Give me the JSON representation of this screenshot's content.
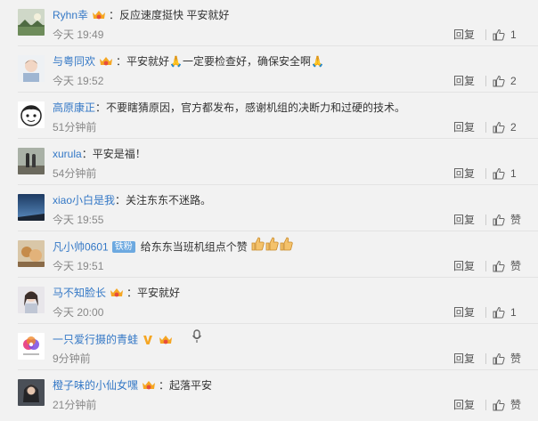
{
  "reply_label": "回复",
  "zan_label": "赞",
  "comments": [
    {
      "user": "Ryhn幸",
      "text": "：反应速度挺快 平安就好",
      "time": "今天 19:49",
      "likes": "1",
      "avatar": "landscape-avatar"
    },
    {
      "user": "与粤同欢",
      "text": "：平安就好🙏一定要检查好，确保安全啊🙏",
      "time": "今天 19:52",
      "likes": "2",
      "avatar": "child-avatar"
    },
    {
      "user": "高原康正",
      "text": "：不要瞎猜原因，官方都发布，感谢机组的决断力和过硬的技术。",
      "time": "51分钟前",
      "likes": "2",
      "avatar": "cartoon-face-avatar"
    },
    {
      "user": "xurula",
      "text": "：平安是福！",
      "time": "54分钟前",
      "likes": "1",
      "avatar": "couple-avatar"
    },
    {
      "user": "xiao小白是我",
      "text": "：关注东东不迷路。",
      "time": "今天 19:55",
      "likes": "",
      "avatar": "night-sky-avatar"
    },
    {
      "user": "凡小帅0601",
      "fan_badge": "铁粉",
      "text": "给东东当班机组点个赞",
      "time": "今天 19:51",
      "likes": "",
      "avatar": "photo-avatar"
    },
    {
      "user": "马不知脸长",
      "text": "：平安就好",
      "time": "今天 20:00",
      "likes": "1",
      "avatar": "girl-avatar"
    },
    {
      "user": "一只爱行摄的青蛙",
      "text": "",
      "time": "9分钟前",
      "likes": "",
      "avatar": "logo-avatar"
    },
    {
      "user": "橙子味的小仙女嘿",
      "text": "：起落平安",
      "time": "21分钟前",
      "likes": "",
      "avatar": "dark-avatar"
    }
  ],
  "colors": {
    "username": "#3478c6",
    "badge": "#f5a623",
    "fan_badge": "#6da9e0"
  }
}
